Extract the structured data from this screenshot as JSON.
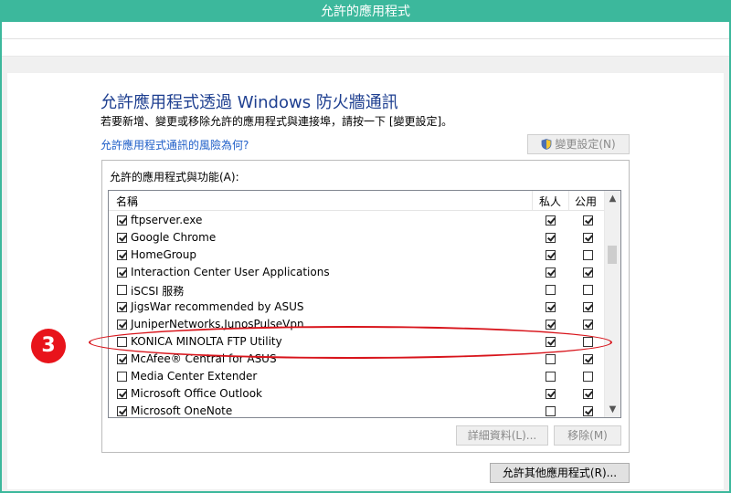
{
  "window": {
    "title": "允許的應用程式"
  },
  "page": {
    "heading": "允許應用程式透過 Windows 防火牆通訊",
    "subtitle": "若要新增、變更或移除允許的應用程式與連接埠，請按一下 [變更設定]。",
    "risk_link": "允許應用程式通訊的風險為何?",
    "change_settings_button": "變更設定(N)",
    "list_label": "允許的應用程式與功能(A):",
    "columns": {
      "name": "名稱",
      "private": "私人",
      "public": "公用"
    },
    "apps": [
      {
        "name": "ftpserver.exe",
        "enabled": true,
        "private": true,
        "public": true
      },
      {
        "name": "Google Chrome",
        "enabled": true,
        "private": true,
        "public": true
      },
      {
        "name": "HomeGroup",
        "enabled": true,
        "private": true,
        "public": false
      },
      {
        "name": "Interaction Center User Applications",
        "enabled": true,
        "private": true,
        "public": true
      },
      {
        "name": "iSCSI 服務",
        "enabled": false,
        "private": false,
        "public": false
      },
      {
        "name": "JigsWar recommended by ASUS",
        "enabled": true,
        "private": true,
        "public": true
      },
      {
        "name": "JuniperNetworks.JunosPulseVpn",
        "enabled": true,
        "private": true,
        "public": true
      },
      {
        "name": "KONICA MINOLTA FTP Utility",
        "enabled": false,
        "private": true,
        "public": false
      },
      {
        "name": "McAfee® Central for ASUS",
        "enabled": true,
        "private": false,
        "public": true
      },
      {
        "name": "Media Center Extender",
        "enabled": false,
        "private": false,
        "public": false
      },
      {
        "name": "Microsoft Office Outlook",
        "enabled": true,
        "private": true,
        "public": true
      },
      {
        "name": "Microsoft OneNote",
        "enabled": true,
        "private": false,
        "public": true
      }
    ],
    "details_button": "詳細資料(L)...",
    "remove_button": "移除(M)",
    "allow_other_button": "允許其他應用程式(R)..."
  },
  "annotation": {
    "step_number": "3",
    "color": "#e8141b"
  },
  "colors": {
    "title_bar": "#3cb89c",
    "heading": "#1e3f90",
    "link": "#1e5ec8"
  }
}
